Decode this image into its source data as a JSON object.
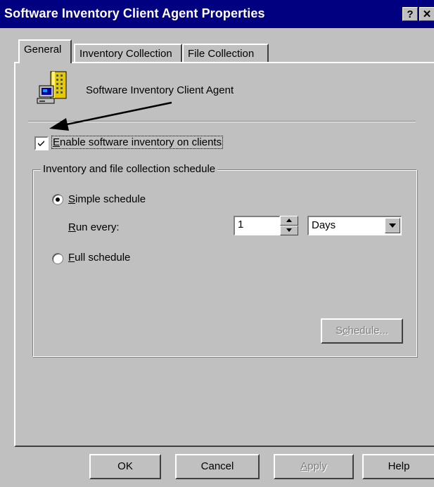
{
  "window": {
    "title": "Software Inventory Client Agent Properties",
    "help_btn": "?",
    "close_btn": "✕"
  },
  "tabs": [
    {
      "label": "General",
      "active": true
    },
    {
      "label": "Inventory Collection",
      "active": false
    },
    {
      "label": "File Collection",
      "active": false
    }
  ],
  "general": {
    "agent_icon": "building-computer-icon",
    "agent_label": "Software Inventory Client Agent",
    "enable_checkbox": {
      "checked": true,
      "label_pre": "",
      "label_mnemonic": "E",
      "label_post": "nable software inventory on clients"
    },
    "schedule_group": {
      "title": "Inventory and file collection schedule",
      "simple": {
        "mnemonic": "S",
        "rest": "imple schedule",
        "selected": true
      },
      "run_every": {
        "mnemonic": "R",
        "rest": "un every:"
      },
      "interval_value": "1",
      "interval_unit": "Days",
      "full": {
        "mnemonic": "F",
        "rest": "ull schedule",
        "selected": false
      },
      "schedule_button": {
        "pre": "S",
        "mnemonic": "c",
        "rest": "hedule...",
        "enabled": false
      }
    }
  },
  "buttons": {
    "ok": "OK",
    "cancel": "Cancel",
    "apply": {
      "mnemonic": "A",
      "rest": "pply",
      "enabled": false
    },
    "help": "Help"
  },
  "annotation": {
    "type": "arrow",
    "color": "#000000"
  }
}
